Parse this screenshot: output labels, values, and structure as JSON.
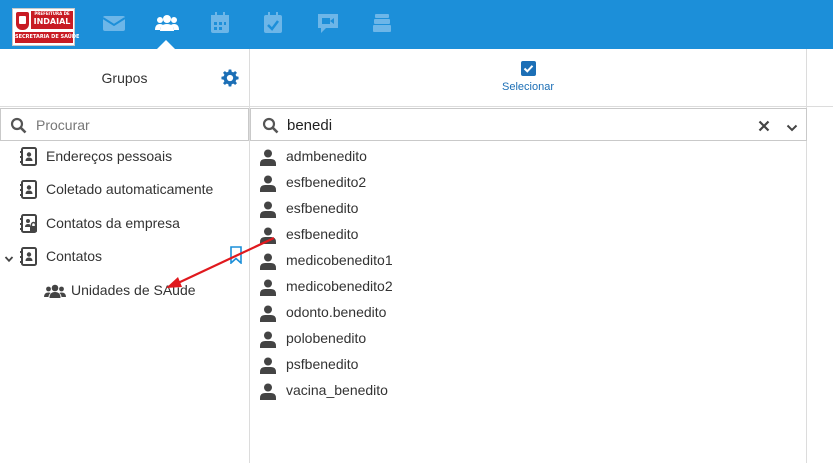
{
  "brand": {
    "logo_line1": "PREFEITURA DE",
    "logo_line2": "INDAIAL",
    "logo_line3": "SECRETARIA DE SAÚDE",
    "color_topbar": "#1c8fd9",
    "color_accent": "#1c6fb6",
    "color_logo_red": "#c81b24"
  },
  "topnav": {
    "items": [
      {
        "icon": "envelope-icon",
        "active": false
      },
      {
        "icon": "users-icon",
        "active": true
      },
      {
        "icon": "calendar-icon",
        "active": false
      },
      {
        "icon": "calendar-check-icon",
        "active": false
      },
      {
        "icon": "video-chat-icon",
        "active": false
      },
      {
        "icon": "stack-icon",
        "active": false
      }
    ]
  },
  "left": {
    "title": "Grupos",
    "search_placeholder": "Procurar",
    "items": [
      {
        "label": "Endereços pessoais",
        "icon": "address-book-icon"
      },
      {
        "label": "Coletado automaticamente",
        "icon": "address-book-icon"
      },
      {
        "label": "Contatos da empresa",
        "icon": "address-book-lock-icon"
      },
      {
        "label": "Contatos",
        "icon": "address-book-icon",
        "expanded": true
      },
      {
        "label": "Unidades de SAude",
        "icon": "group-icon"
      }
    ]
  },
  "right": {
    "select_label": "Selecionar",
    "search_value": "benedi",
    "contacts": [
      "admbenedito",
      "esfbenedito2",
      "esfbenedito",
      "esfbenedito",
      "medicobenedito1",
      "medicobenedito2",
      "odonto.benedito",
      "polobenedito",
      "psfbenedito",
      "vacina_benedito"
    ]
  },
  "annotation": {
    "type": "arrow",
    "color": "#e0191e"
  }
}
